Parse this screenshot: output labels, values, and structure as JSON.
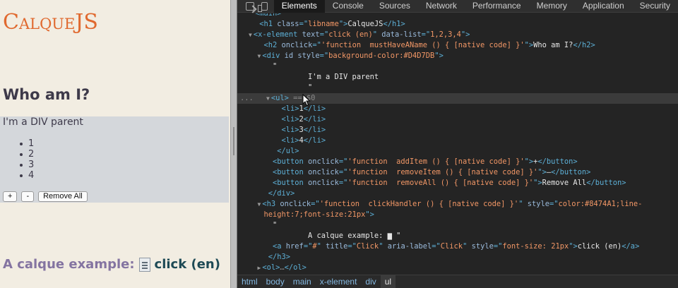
{
  "page": {
    "libname": "CalqueJS",
    "who_heading": "Who am I?",
    "parent_text": "I'm a DIV parent",
    "list_items": [
      "1",
      "2",
      "3",
      "4"
    ],
    "buttons": {
      "add": "+",
      "remove": "-",
      "remove_all": "Remove All"
    },
    "calque_prefix": "A calque example:",
    "calque_link": "click (en)",
    "colors": {
      "libname": "#e0692f",
      "calque": "#8474A1",
      "div_bg": "#D4D7DB"
    }
  },
  "devtools": {
    "tabs": [
      "Elements",
      "Console",
      "Sources",
      "Network",
      "Performance",
      "Memory",
      "Application",
      "Security"
    ],
    "active_tab": "Elements",
    "icons": [
      "inspect-element-icon",
      "device-toolbar-icon"
    ],
    "breadcrumbs": [
      "html",
      "body",
      "main",
      "x-element",
      "div",
      "ul"
    ],
    "active_crumb": "ul",
    "selected_marker": "== $0",
    "gutter_dots": "..."
  },
  "dom_lines": [
    {
      "i": 4,
      "parts": [
        [
          "tag",
          "<main>"
        ]
      ]
    },
    {
      "i": 5,
      "parts": [
        [
          "tag",
          "<h1 "
        ],
        [
          "attr",
          "class"
        ],
        [
          "tag",
          "=\""
        ],
        [
          "val",
          "libname"
        ],
        [
          "tag",
          "\">"
        ],
        [
          "txt",
          "CalqueJS"
        ],
        [
          "tag",
          "</h1>"
        ]
      ]
    },
    {
      "i": 4,
      "a": "▼",
      "parts": [
        [
          "tag",
          "<x-element "
        ],
        [
          "attr",
          "text"
        ],
        [
          "tag",
          "=\""
        ],
        [
          "val",
          "click (en)"
        ],
        [
          "tag",
          "\" "
        ],
        [
          "attr",
          "data-list"
        ],
        [
          "tag",
          "=\""
        ],
        [
          "val",
          "1,2,3,4"
        ],
        [
          "tag",
          "\">"
        ]
      ]
    },
    {
      "i": 6,
      "parts": [
        [
          "tag",
          "<h2 "
        ],
        [
          "attr",
          "onclick"
        ],
        [
          "tag",
          "=\""
        ],
        [
          "val",
          "'function  mustHaveAName () { [native code] }'"
        ],
        [
          "tag",
          "\">"
        ],
        [
          "txt",
          "Who am I?"
        ],
        [
          "tag",
          "</h2>"
        ]
      ]
    },
    {
      "i": 6,
      "a": "▼",
      "parts": [
        [
          "tag",
          "<div "
        ],
        [
          "attr",
          "id style"
        ],
        [
          "tag",
          "=\""
        ],
        [
          "val",
          "background-color:#D4D7DB"
        ],
        [
          "tag",
          "\">"
        ]
      ]
    },
    {
      "i": 8,
      "parts": [
        [
          "txt",
          "\""
        ]
      ]
    },
    {
      "i": 16,
      "parts": [
        [
          "txt",
          "I'm a DIV parent"
        ]
      ]
    },
    {
      "i": 16,
      "parts": [
        [
          "txt",
          "\""
        ]
      ]
    },
    {
      "i": 8,
      "a": "▼",
      "sel": true,
      "parts": [
        [
          "tag",
          "<ul> "
        ],
        [
          "dim",
          "== $0"
        ]
      ]
    },
    {
      "i": 10,
      "parts": [
        [
          "tag",
          "<li>"
        ],
        [
          "txt",
          "1"
        ],
        [
          "tag",
          "</li>"
        ]
      ]
    },
    {
      "i": 10,
      "parts": [
        [
          "tag",
          "<li>"
        ],
        [
          "txt",
          "2"
        ],
        [
          "tag",
          "</li>"
        ]
      ]
    },
    {
      "i": 10,
      "parts": [
        [
          "tag",
          "<li>"
        ],
        [
          "txt",
          "3"
        ],
        [
          "tag",
          "</li>"
        ]
      ]
    },
    {
      "i": 10,
      "parts": [
        [
          "tag",
          "<li>"
        ],
        [
          "txt",
          "4"
        ],
        [
          "tag",
          "</li>"
        ]
      ]
    },
    {
      "i": 9,
      "parts": [
        [
          "tag",
          "</ul>"
        ]
      ]
    },
    {
      "i": 8,
      "parts": [
        [
          "tag",
          "<button "
        ],
        [
          "attr",
          "onclick"
        ],
        [
          "tag",
          "=\""
        ],
        [
          "val",
          "'function  addItem () { [native code] }'"
        ],
        [
          "tag",
          "\">"
        ],
        [
          "txt",
          "+"
        ],
        [
          "tag",
          "</button>"
        ]
      ]
    },
    {
      "i": 8,
      "parts": [
        [
          "tag",
          "<button "
        ],
        [
          "attr",
          "onclick"
        ],
        [
          "tag",
          "=\""
        ],
        [
          "val",
          "'function  removeItem () { [native code] }'"
        ],
        [
          "tag",
          "\">"
        ],
        [
          "txt",
          "–"
        ],
        [
          "tag",
          "</button>"
        ]
      ]
    },
    {
      "i": 8,
      "parts": [
        [
          "tag",
          "<button "
        ],
        [
          "attr",
          "onclick"
        ],
        [
          "tag",
          "=\""
        ],
        [
          "val",
          "'function  removeAll () { [native code] }'"
        ],
        [
          "tag",
          "\">"
        ],
        [
          "txt",
          "Remove All"
        ],
        [
          "tag",
          "</button>"
        ]
      ]
    },
    {
      "i": 7,
      "parts": [
        [
          "tag",
          "</div>"
        ]
      ]
    },
    {
      "i": 6,
      "a": "▼",
      "parts": [
        [
          "tag",
          "<h3 "
        ],
        [
          "attr",
          "onclick"
        ],
        [
          "tag",
          "=\""
        ],
        [
          "val",
          "'function  clickHandler () { [native code] }'"
        ],
        [
          "tag",
          "\" "
        ],
        [
          "attr",
          "style"
        ],
        [
          "tag",
          "=\""
        ],
        [
          "val",
          "color:#8474A1;line-"
        ]
      ]
    },
    {
      "i": 6,
      "parts": [
        [
          "val",
          "height:7;font-size:21px"
        ],
        [
          "tag",
          "\">"
        ]
      ]
    },
    {
      "i": 8,
      "parts": [
        [
          "txt",
          "\""
        ]
      ]
    },
    {
      "i": 16,
      "parts": [
        [
          "txt",
          "A calque example: "
        ],
        [
          "txt",
          "▆"
        ],
        [
          "txt",
          " \""
        ]
      ]
    },
    {
      "i": 8,
      "parts": [
        [
          "tag",
          "<a "
        ],
        [
          "attr",
          "href"
        ],
        [
          "tag",
          "=\""
        ],
        [
          "val",
          "#"
        ],
        [
          "tag",
          "\" "
        ],
        [
          "attr",
          "title"
        ],
        [
          "tag",
          "=\""
        ],
        [
          "val",
          "Click"
        ],
        [
          "tag",
          "\" "
        ],
        [
          "attr",
          "aria-label"
        ],
        [
          "tag",
          "=\""
        ],
        [
          "val",
          "Click"
        ],
        [
          "tag",
          "\" "
        ],
        [
          "attr",
          "style"
        ],
        [
          "tag",
          "=\""
        ],
        [
          "val",
          "font-size: 21px"
        ],
        [
          "tag",
          "\">"
        ],
        [
          "txt",
          "click (en)"
        ],
        [
          "tag",
          "</a>"
        ]
      ]
    },
    {
      "i": 7,
      "parts": [
        [
          "tag",
          "</h3>"
        ]
      ]
    },
    {
      "i": 6,
      "a": "▶",
      "parts": [
        [
          "tag",
          "<ol>"
        ],
        [
          "ell",
          "…"
        ],
        [
          "tag",
          "</ol>"
        ]
      ]
    }
  ]
}
